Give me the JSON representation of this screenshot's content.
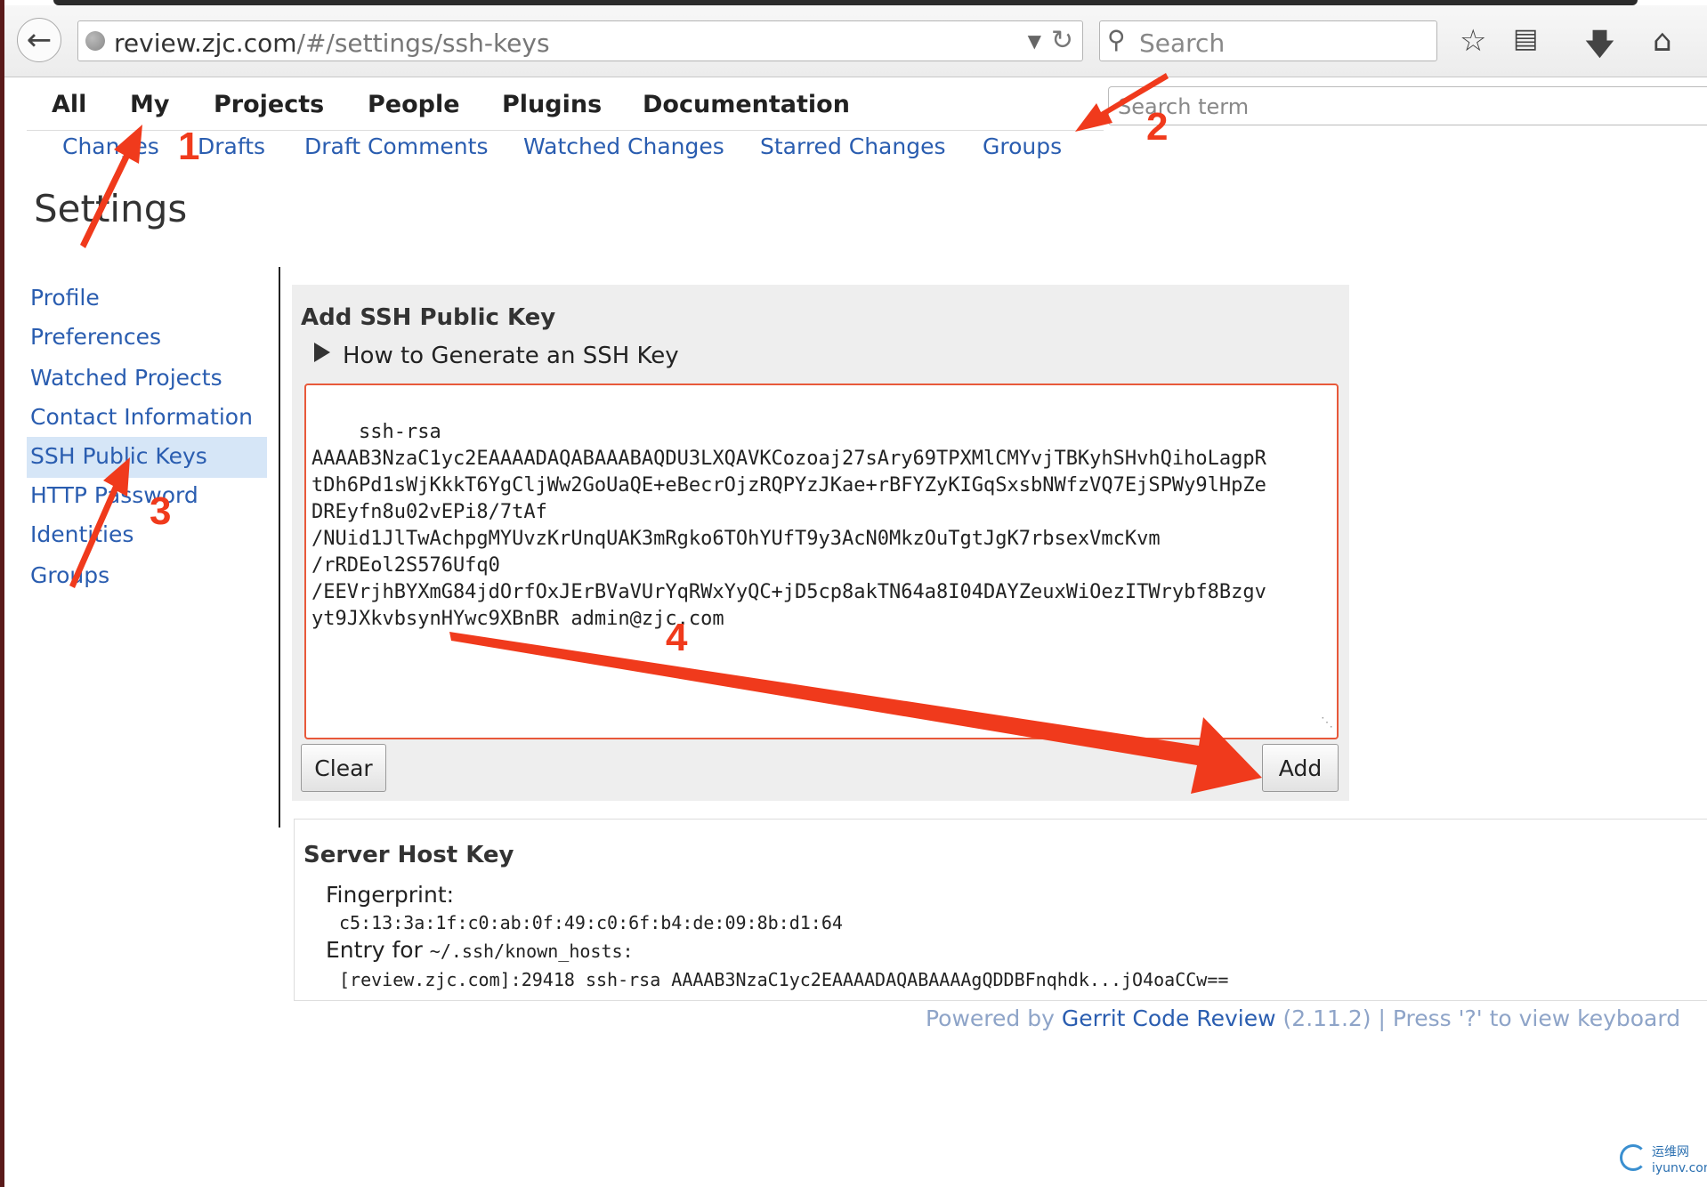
{
  "browser": {
    "url_domain": "review.zjc.com",
    "url_path": "/#/settings/ssh-keys",
    "search_placeholder": "Search"
  },
  "topnav": [
    "All",
    "My",
    "Projects",
    "People",
    "Plugins",
    "Documentation"
  ],
  "search_term_placeholder": "Search term",
  "subnav": [
    "Changes",
    "Drafts",
    "Draft Comments",
    "Watched Changes",
    "Starred Changes",
    "Groups"
  ],
  "page_title": "Settings",
  "sidebar": [
    "Profile",
    "Preferences",
    "Watched Projects",
    "Contact Information",
    "SSH Public Keys",
    "HTTP Password",
    "Identities",
    "Groups"
  ],
  "sidebar_selected": "SSH Public Keys",
  "add_key": {
    "title": "Add SSH Public Key",
    "howto": "How to Generate an SSH Key",
    "key_text": "ssh-rsa\nAAAAB3NzaC1yc2EAAAADAQABAAABAQDU3LXQAVKCozoaj27sAry69TPXMlCMYvjTBKyhSHvhQihoLagpR\ntDh6Pd1sWjKkkT6YgCljWw2GoUaQE+eBecrOjzRQPYzJKae+rBFYZyKIGqSxsbNWfzVQ7EjSPWy9lHpZe\nDREyfn8u02vEPi8/7tAf\n/NUid1JlTwAchpgMYUvzKrUnqUAK3mRgko6TOhYUfT9y3AcN0MkzOuTgtJgK7rbsexVmcKvm\n/rRDEol2S576Ufq0\n/EEVrjhBYXmG84jdOrfOxJErBVaVUrYqRWxYyQC+jD5cp8akTN64a8I04DAYZeuxWiOezITWrybf8Bzgv\nyt9JXkvbsynHYwc9XBnBR admin@zjc.com",
    "clear_label": "Clear",
    "add_label": "Add"
  },
  "host_key": {
    "title": "Server Host Key",
    "fingerprint_label": "Fingerprint:",
    "fingerprint": "c5:13:3a:1f:c0:ab:0f:49:c0:6f:b4:de:09:8b:d1:64",
    "entry_label": "Entry for",
    "entry_path": "~/.ssh/known_hosts:",
    "entry_value": "[review.zjc.com]:29418 ssh-rsa AAAAB3NzaC1yc2EAAAADAQABAAAAgQDDBFnqhdk...jO4oaCCw=="
  },
  "footer": {
    "prefix": "Powered by",
    "link": "Gerrit Code Review",
    "suffix": "(2.11.2) | Press '?' to view keyboard"
  },
  "annotations": [
    "1",
    "2",
    "3",
    "4"
  ],
  "annotation_color": "#f03a1c",
  "watermark": {
    "line1": "运维网",
    "line2": "iyunv.com"
  }
}
